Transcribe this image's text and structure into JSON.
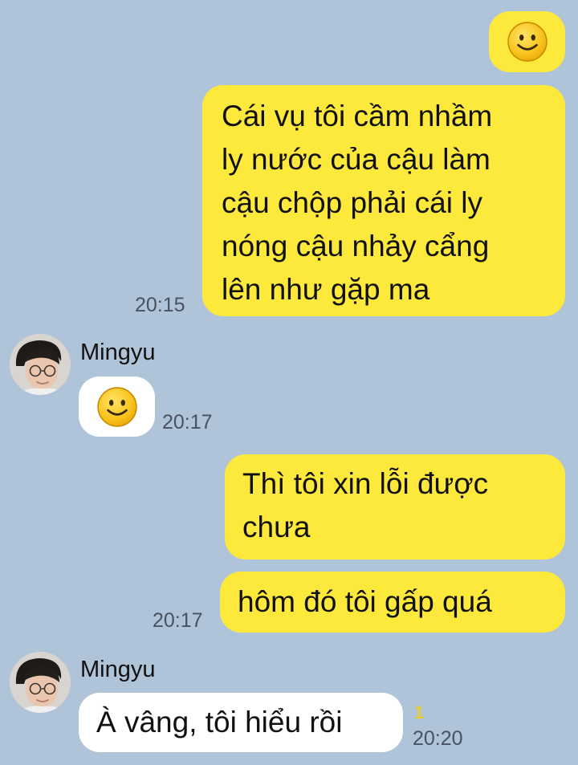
{
  "messages": [
    {
      "id": "m1",
      "dir": "out",
      "type": "emoji",
      "icon": "slightly-smiling-face-icon"
    },
    {
      "id": "m2",
      "dir": "out",
      "type": "text",
      "text": "Cái vụ tôi cầm nhầm\nly nước của cậu làm\ncậu chộp phải cái ly\nnóng cậu nhảy cẩng\nlên như gặp ma",
      "time": "20:15"
    },
    {
      "id": "m3",
      "dir": "in",
      "sender": "Mingyu",
      "type": "emoji",
      "icon": "slightly-smiling-face-icon",
      "time": "20:17"
    },
    {
      "id": "m4",
      "dir": "out",
      "type": "text",
      "text": "Thì tôi xin lỗi được\nchưa"
    },
    {
      "id": "m5",
      "dir": "out",
      "type": "text",
      "text": "hôm đó tôi gấp quá",
      "time": "20:17"
    },
    {
      "id": "m6",
      "dir": "in",
      "sender": "Mingyu",
      "type": "text",
      "text": "À vâng, tôi hiểu rồi",
      "time": "20:20",
      "unread": "1"
    }
  ],
  "colors": {
    "background": "#b0c4d9",
    "outgoing_bubble": "#fde83c",
    "incoming_bubble": "#ffffff",
    "unread_count": "#e9cf2b",
    "timestamp": "#4a5260"
  }
}
